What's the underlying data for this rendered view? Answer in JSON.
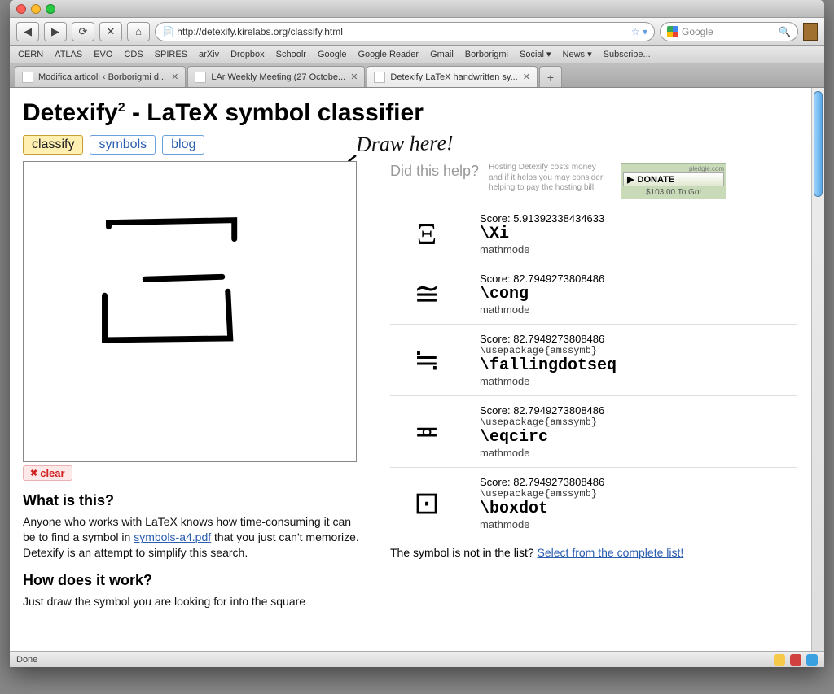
{
  "browser": {
    "url": "http://detexify.kirelabs.org/classify.html",
    "search_placeholder": "Google",
    "bookmarks": [
      "CERN",
      "ATLAS",
      "EVO",
      "CDS",
      "SPIRES",
      "arXiv",
      "Dropbox",
      "Schoolr",
      "Google",
      "Google Reader",
      "Gmail",
      "Borborigmi",
      "Social ▾",
      "News ▾",
      "Subscribe..."
    ],
    "tabs": [
      {
        "label": "Modifica articoli ‹ Borborigmi d..."
      },
      {
        "label": "LAr Weekly Meeting (27 Octobe..."
      },
      {
        "label": "Detexify LaTeX handwritten sy..."
      }
    ],
    "status": "Done"
  },
  "page": {
    "title_prefix": "Detexify",
    "title_suffix": " - LaTeX symbol classifier",
    "nav": {
      "classify": "classify",
      "symbols": "symbols",
      "blog": "blog"
    },
    "handwrite": "Draw here!",
    "clear": "clear",
    "what_h": "What is this?",
    "what_p1": "Anyone who works with LaTeX knows how time-consuming it can be to find a symbol in ",
    "what_link": "symbols-a4.pdf",
    "what_p2": " that you just can't memorize. Detexify is an attempt to simplify this search.",
    "how_h": "How does it work?",
    "how_p": "Just draw the symbol you are looking for into the square",
    "didhelp": "Did this help?",
    "hostnote": "Hosting Detexify costs money and if it helps you may consider helping to pay the hosting bill.",
    "donate": {
      "label": "DONATE",
      "pledgie": "pledgie.com",
      "togo": "$103.00 To Go!"
    },
    "notlist_pre": "The symbol is not in the list? ",
    "notlist_link": "Select from the complete list!"
  },
  "results": [
    {
      "symbol": "Ξ",
      "score": "5.91392338434633",
      "package": "",
      "command": "\\Xi",
      "mode": "mathmode"
    },
    {
      "symbol": "≅",
      "score": "82.7949273808486",
      "package": "",
      "command": "\\cong",
      "mode": "mathmode"
    },
    {
      "symbol": "≒",
      "score": "82.7949273808486",
      "package": "\\usepackage{amssymb}",
      "command": "\\fallingdotseq",
      "mode": "mathmode"
    },
    {
      "symbol": "≖",
      "score": "82.7949273808486",
      "package": "\\usepackage{amssymb}",
      "command": "\\eqcirc",
      "mode": "mathmode"
    },
    {
      "symbol": "⊡",
      "score": "82.7949273808486",
      "package": "\\usepackage{amssymb}",
      "command": "\\boxdot",
      "mode": "mathmode"
    }
  ]
}
